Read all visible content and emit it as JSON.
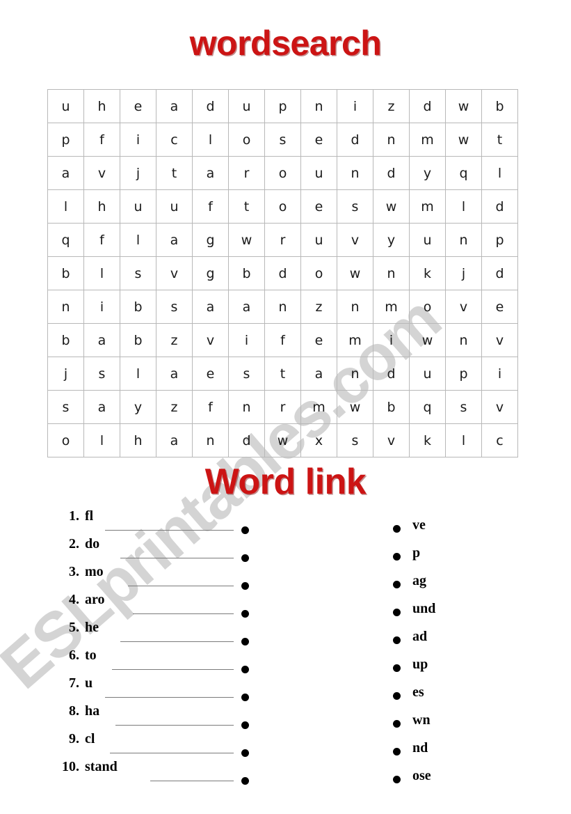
{
  "page": {
    "background_color": "#ffffff",
    "accent_color": "#cc1414"
  },
  "watermark": {
    "text": "ESLprintables.com",
    "color": "#c9c9c9"
  },
  "headings": {
    "wordsearch_title": "wordsearch",
    "wordlink_title": "Word link"
  },
  "wordsearch": {
    "rows": 11,
    "cols": 13,
    "grid": [
      [
        "u",
        "h",
        "e",
        "a",
        "d",
        "u",
        "p",
        "n",
        "i",
        "z",
        "d",
        "w",
        "b"
      ],
      [
        "p",
        "f",
        "i",
        "c",
        "l",
        "o",
        "s",
        "e",
        "d",
        "n",
        "m",
        "w",
        "t"
      ],
      [
        "a",
        "v",
        "j",
        "t",
        "a",
        "r",
        "o",
        "u",
        "n",
        "d",
        "y",
        "q",
        "l"
      ],
      [
        "l",
        "h",
        "u",
        "u",
        "f",
        "t",
        "o",
        "e",
        "s",
        "w",
        "m",
        "l",
        "d"
      ],
      [
        "q",
        "f",
        "l",
        "a",
        "g",
        "w",
        "r",
        "u",
        "v",
        "y",
        "u",
        "n",
        "p"
      ],
      [
        "b",
        "l",
        "s",
        "v",
        "g",
        "b",
        "d",
        "o",
        "w",
        "n",
        "k",
        "j",
        "d"
      ],
      [
        "n",
        "i",
        "b",
        "s",
        "a",
        "a",
        "n",
        "z",
        "n",
        "m",
        "o",
        "v",
        "e"
      ],
      [
        "b",
        "a",
        "b",
        "z",
        "v",
        "i",
        "f",
        "e",
        "m",
        "i",
        "w",
        "n",
        "v"
      ],
      [
        "j",
        "s",
        "l",
        "a",
        "e",
        "s",
        "t",
        "a",
        "n",
        "d",
        "u",
        "p",
        "i"
      ],
      [
        "s",
        "a",
        "y",
        "z",
        "f",
        "n",
        "r",
        "m",
        "w",
        "b",
        "q",
        "s",
        "v"
      ],
      [
        "o",
        "l",
        "h",
        "a",
        "n",
        "d",
        "w",
        "x",
        "s",
        "v",
        "k",
        "l",
        "c"
      ]
    ]
  },
  "wordlink": {
    "left_column": [
      {
        "number": "1.",
        "fragment": "fl",
        "line_width": 185
      },
      {
        "number": "2.",
        "fragment": "do",
        "line_width": 163
      },
      {
        "number": "3.",
        "fragment": "mo",
        "line_width": 152
      },
      {
        "number": "4.",
        "fragment": "aro",
        "line_width": 145
      },
      {
        "number": "5.",
        "fragment": "he",
        "line_width": 163
      },
      {
        "number": "6.",
        "fragment": "to",
        "line_width": 175
      },
      {
        "number": "7.",
        "fragment": "u",
        "line_width": 185
      },
      {
        "number": "8.",
        "fragment": "ha",
        "line_width": 170
      },
      {
        "number": "9.",
        "fragment": "cl",
        "line_width": 178
      },
      {
        "number": "10.",
        "fragment": "stand",
        "line_width": 120
      }
    ],
    "right_column": [
      {
        "fragment": "ve"
      },
      {
        "fragment": "p"
      },
      {
        "fragment": "ag"
      },
      {
        "fragment": "und"
      },
      {
        "fragment": "ad"
      },
      {
        "fragment": "up"
      },
      {
        "fragment": "es"
      },
      {
        "fragment": "wn"
      },
      {
        "fragment": "nd"
      },
      {
        "fragment": "ose"
      }
    ]
  }
}
